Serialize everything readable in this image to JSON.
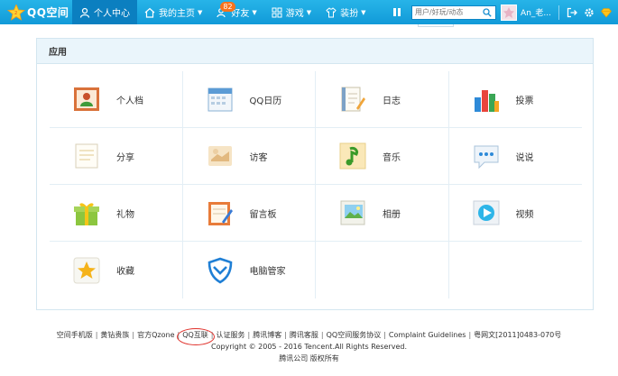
{
  "topbar": {
    "logo_text": "QQ空间",
    "nav": [
      {
        "label": "个人中心",
        "icon": "user-icon",
        "active": true
      },
      {
        "label": "我的主页",
        "icon": "home-icon"
      },
      {
        "label": "好友",
        "icon": "friends-icon",
        "badge": "82"
      },
      {
        "label": "游戏",
        "icon": "games-icon"
      },
      {
        "label": "装扮",
        "icon": "dress-up-icon"
      }
    ],
    "search_placeholder": "用户/好玩/动态",
    "username": "An_老...",
    "accent": "#1aa5e0"
  },
  "panel": {
    "title": "应用",
    "apps": [
      {
        "label": "个人档",
        "icon": "profile-card-icon"
      },
      {
        "label": "QQ日历",
        "icon": "calendar-icon"
      },
      {
        "label": "日志",
        "icon": "blog-icon"
      },
      {
        "label": "投票",
        "icon": "vote-icon"
      },
      {
        "label": "分享",
        "icon": "share-icon"
      },
      {
        "label": "访客",
        "icon": "visitor-icon"
      },
      {
        "label": "音乐",
        "icon": "music-icon"
      },
      {
        "label": "说说",
        "icon": "chat-icon"
      },
      {
        "label": "礼物",
        "icon": "gift-icon"
      },
      {
        "label": "留言板",
        "icon": "message-board-icon"
      },
      {
        "label": "相册",
        "icon": "album-icon"
      },
      {
        "label": "视频",
        "icon": "video-icon"
      },
      {
        "label": "收藏",
        "icon": "favorite-icon"
      },
      {
        "label": "电脑管家",
        "icon": "pc-manager-icon"
      }
    ]
  },
  "footer": {
    "links": [
      "空间手机版",
      "黄钻贵族",
      "官方Qzone",
      "QQ互联",
      "认证服务",
      "腾讯博客",
      "腾讯客服",
      "QQ空间服务协议",
      "Complaint Guidelines",
      "粤网文[2011]0483-070号"
    ],
    "copyright": "Copyright © 2005 - 2016 Tencent.All Rights Reserved.",
    "company": "腾讯公司 版权所有"
  }
}
